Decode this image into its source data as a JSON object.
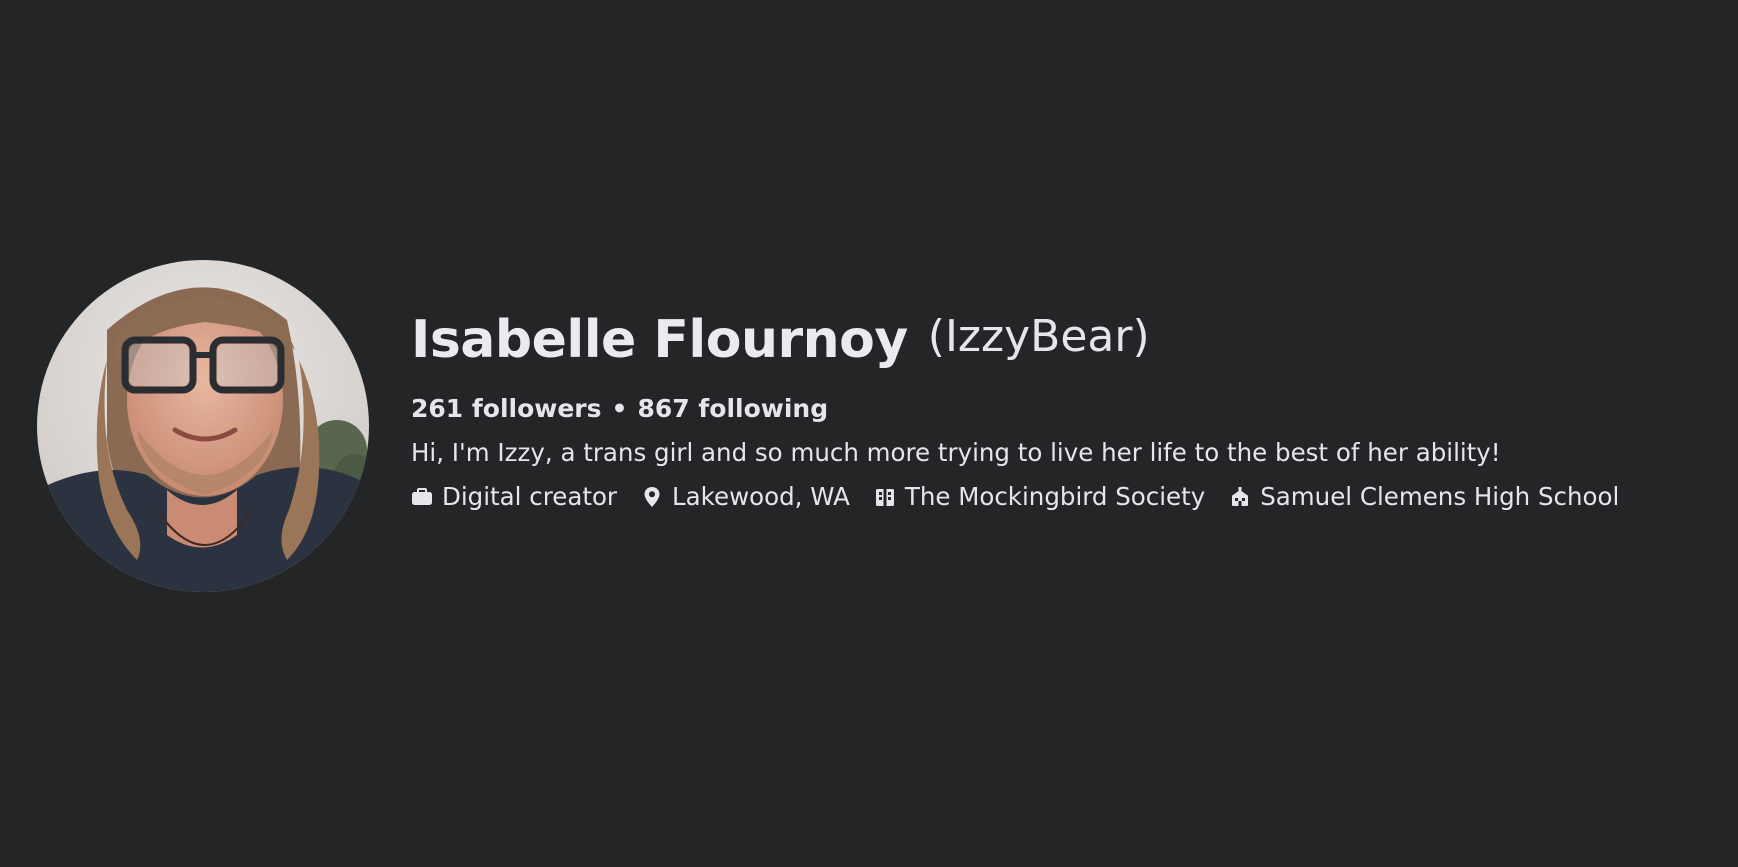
{
  "profile": {
    "name": "Isabelle Flournoy",
    "nickname": "(IzzyBear)",
    "followers_text": "261 followers",
    "separator": "•",
    "following_text": "867 following",
    "bio": "Hi, I'm Izzy, a trans girl and so much more trying to live her life to the best of her ability!",
    "details": [
      {
        "icon": "briefcase-icon",
        "label": "Digital creator"
      },
      {
        "icon": "location-pin-icon",
        "label": "Lakewood, WA"
      },
      {
        "icon": "building-icon",
        "label": "The Mockingbird Society"
      },
      {
        "icon": "school-icon",
        "label": "Samuel Clemens High School"
      }
    ]
  },
  "colors": {
    "background": "#242527",
    "text": "#e4e6eb"
  }
}
